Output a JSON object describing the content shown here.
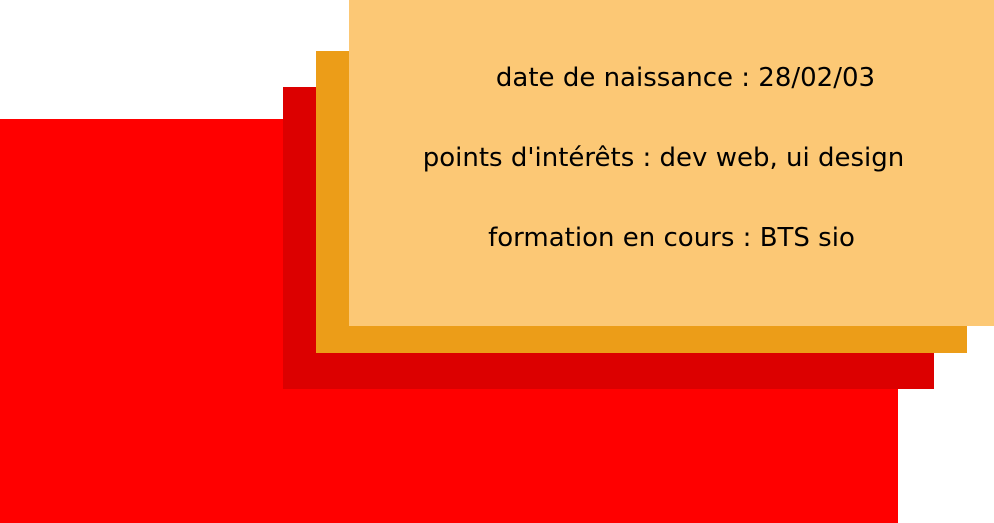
{
  "colors": {
    "background": "#ffffff",
    "layer_red": "#ff0000",
    "layer_dark_red": "#dc0000",
    "layer_orange": "#ec9d18",
    "card": "#fcc875",
    "text": "#000000"
  },
  "card": {
    "lines": [
      "date de naissance : 28/02/03",
      "points d'intérêts : dev web, ui design",
      "formation en cours : BTS sio"
    ]
  }
}
